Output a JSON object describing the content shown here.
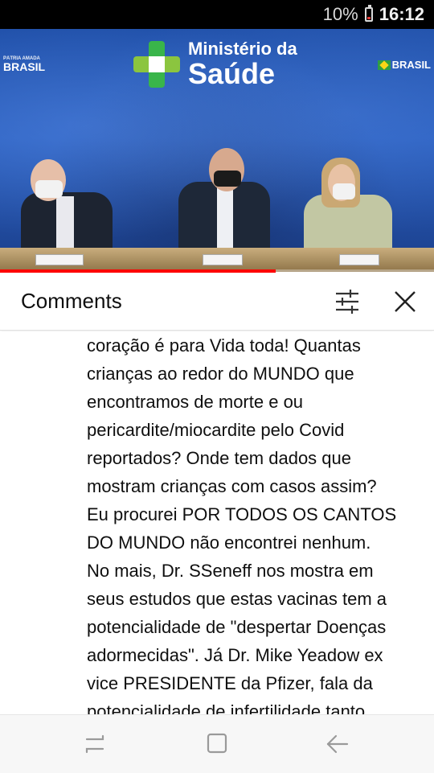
{
  "status_bar": {
    "battery_percent": "10%",
    "time": "16:12"
  },
  "video": {
    "ministry_line1": "Ministério da",
    "ministry_line2": "Saúde",
    "brasil_left_small": "PÁTRIA AMADA",
    "brasil_left_big": "BRASIL",
    "brasil_right": "BRASIL",
    "progress": 0.635
  },
  "comments_panel": {
    "title": "Comments",
    "filter_icon": "sort-filter-icon",
    "close_icon": "close-icon"
  },
  "comment": {
    "lines": [
      "coração é para Vida toda! Quantas",
      "crianças ao redor do MUNDO que",
      "encontramos de morte e ou",
      "pericardite/miocardite pelo Covid",
      "reportados? Onde tem dados que",
      "mostram crianças com casos assim?",
      "Eu procurei POR TODOS OS CANTOS",
      "DO MUNDO não encontrei nenhum.",
      "No mais, Dr. SSeneff nos mostra em",
      "seus estudos que estas vacinas tem a",
      "potencialidade de \"despertar Doenças",
      "adormecidas\". Já Dr. Mike Yeadow ex",
      "vice PRESIDENTE da Pfizer, fala da",
      "potencialidade de infertilidade tanto"
    ]
  },
  "nav_bar": {
    "recent_icon": "recent-apps-icon",
    "home_icon": "home-icon",
    "back_icon": "back-icon"
  }
}
